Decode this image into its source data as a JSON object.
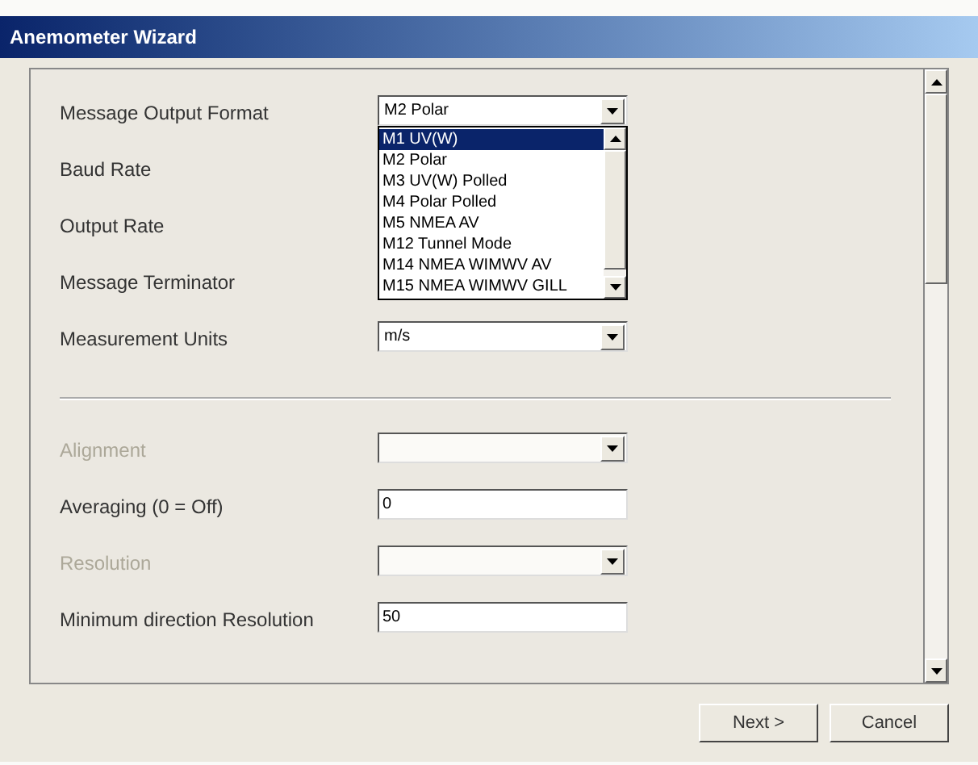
{
  "window": {
    "title": "Anemometer Wizard"
  },
  "fields": [
    {
      "label": "Message Output Format",
      "kind": "select",
      "value": "M2 Polar",
      "disabled": false,
      "open": true
    },
    {
      "label": "Baud Rate",
      "kind": "hidden",
      "disabled": false
    },
    {
      "label": "Output Rate",
      "kind": "hidden",
      "disabled": false
    },
    {
      "label": "Message Terminator",
      "kind": "hidden",
      "disabled": false
    },
    {
      "label": "Measurement Units",
      "kind": "select",
      "value": "m/s",
      "disabled": false
    },
    {
      "kind": "separator"
    },
    {
      "label": "Alignment",
      "kind": "select",
      "disabled": true
    },
    {
      "label": "Averaging (0 = Off)",
      "kind": "input",
      "value": "0",
      "disabled": false
    },
    {
      "label": "Resolution",
      "kind": "select",
      "disabled": true
    },
    {
      "label": "Minimum direction Resolution",
      "kind": "input",
      "value": "50",
      "disabled": false
    }
  ],
  "dropdown_list": [
    {
      "label": "M1 UV(W)",
      "selected": true
    },
    {
      "label": "M2 Polar",
      "selected": false
    },
    {
      "label": "M3 UV(W) Polled",
      "selected": false
    },
    {
      "label": "M4 Polar Polled",
      "selected": false
    },
    {
      "label": "M5 NMEA AV",
      "selected": false
    },
    {
      "label": "M12 Tunnel Mode",
      "selected": false
    },
    {
      "label": "M14 NMEA WIMWV AV",
      "selected": false
    },
    {
      "label": "M15 NMEA WIMWV GILL",
      "selected": false
    }
  ],
  "buttons": [
    "Next >",
    "Cancel"
  ]
}
